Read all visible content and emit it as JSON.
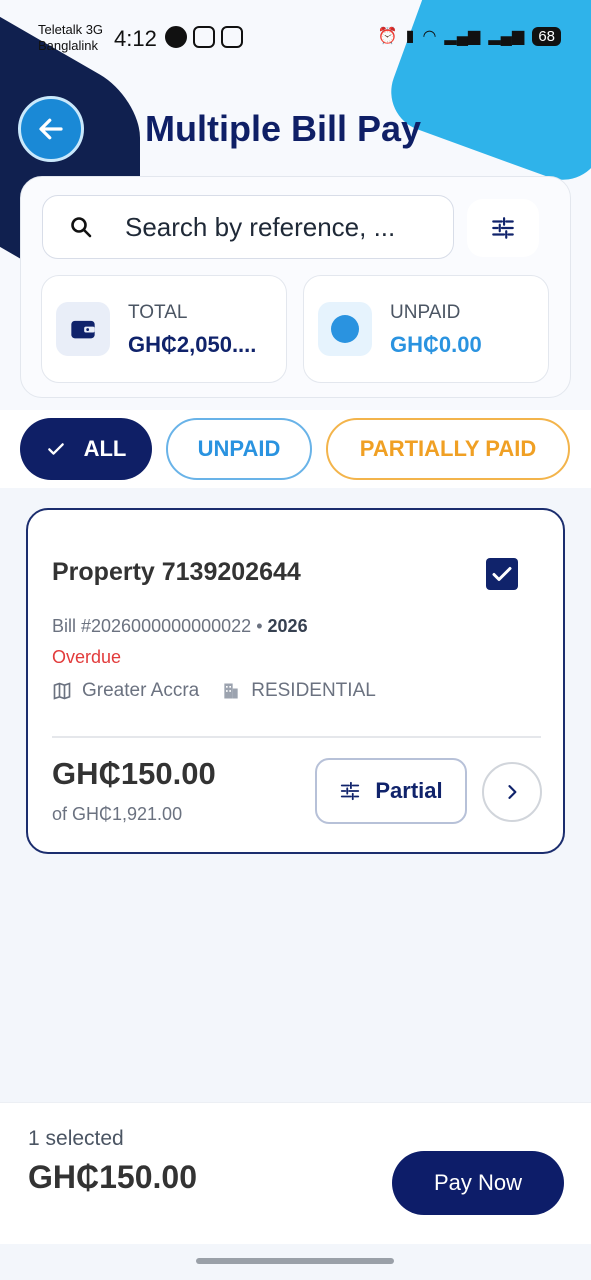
{
  "status_bar": {
    "carrier_line1": "Teletalk 3G",
    "carrier_line2": "Banglalink",
    "time": "4:12",
    "battery": "68"
  },
  "header": {
    "title": "Multiple Bill Pay",
    "back_icon": "arrow-left-icon"
  },
  "search": {
    "placeholder": "Search by reference, ...",
    "filter_icon": "sliders-icon"
  },
  "stats": {
    "total_label": "TOTAL",
    "total_value": "GH₵2,050....",
    "unpaid_label": "UNPAID",
    "unpaid_value": "GH₵0.00"
  },
  "filters": {
    "all": "ALL",
    "unpaid": "UNPAID",
    "partially_paid": "PARTIALLY PAID",
    "selected": "ALL"
  },
  "bill": {
    "property": "Property 7139202644",
    "bill_number": "Bill #2026000000000022",
    "separator": "•",
    "year": "2026",
    "status": "Overdue",
    "region": "Greater Accra",
    "type": "RESIDENTIAL",
    "amount": "GH₵150.00",
    "of_amount": "of GH₵1,921.00",
    "partial_label": "Partial",
    "checked": true
  },
  "footer": {
    "selected_count": "1 selected",
    "selected_total": "GH₵150.00",
    "pay_label": "Pay Now"
  },
  "colors": {
    "primary": "#0f1f66",
    "accent_blue": "#2a93e0",
    "accent_orange": "#f0a024",
    "danger": "#e23b3b"
  }
}
